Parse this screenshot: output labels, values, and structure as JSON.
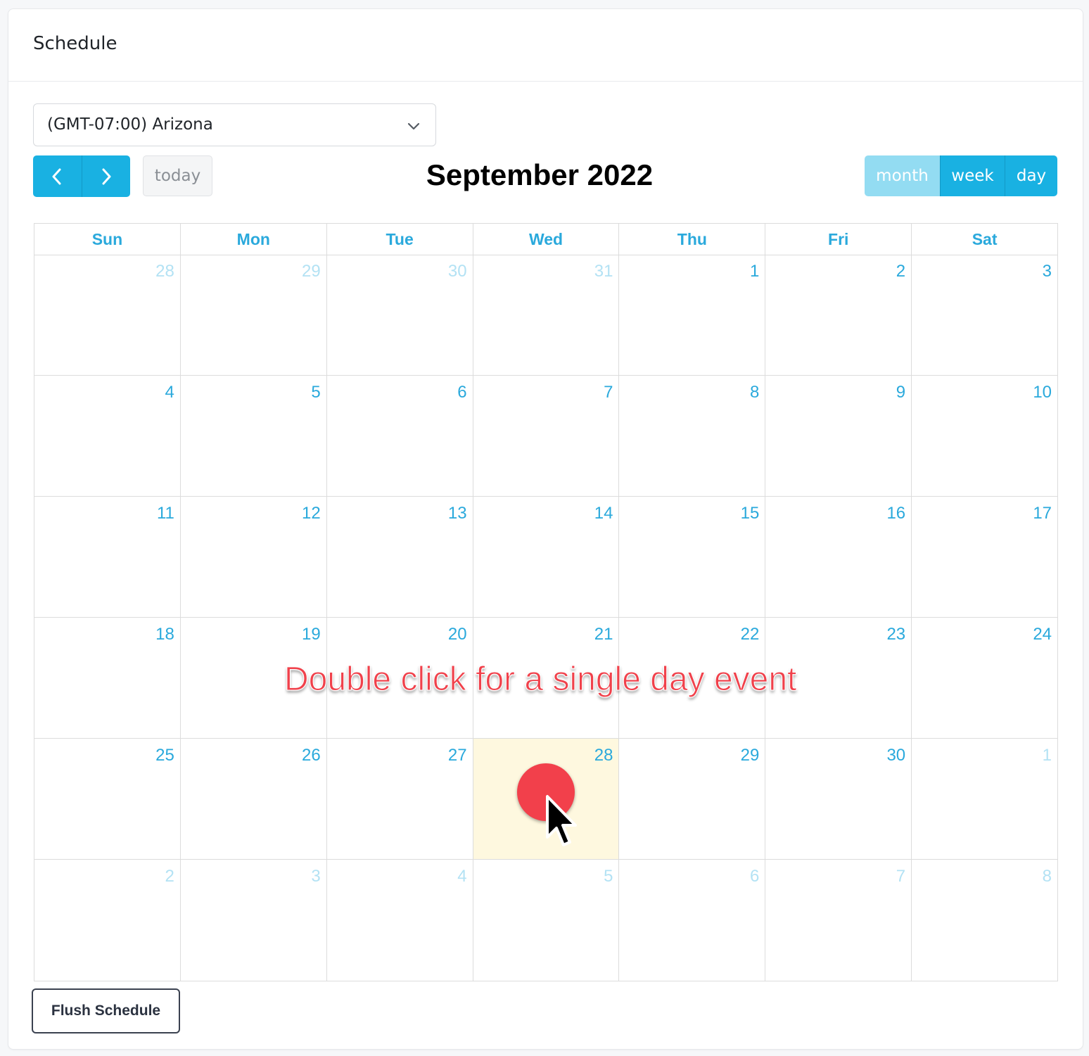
{
  "card": {
    "title": "Schedule"
  },
  "timezone": {
    "selected": "(GMT-07:00) Arizona"
  },
  "toolbar": {
    "prev_icon": "chevron-left-icon",
    "next_icon": "chevron-right-icon",
    "today_label": "today",
    "title": "September 2022",
    "views": [
      {
        "label": "month",
        "active": true
      },
      {
        "label": "week",
        "active": false
      },
      {
        "label": "day",
        "active": false
      }
    ]
  },
  "calendar": {
    "days_of_week": [
      "Sun",
      "Mon",
      "Tue",
      "Wed",
      "Thu",
      "Fri",
      "Sat"
    ],
    "weeks": [
      [
        {
          "n": "28",
          "other": true
        },
        {
          "n": "29",
          "other": true
        },
        {
          "n": "30",
          "other": true
        },
        {
          "n": "31",
          "other": true
        },
        {
          "n": "1"
        },
        {
          "n": "2"
        },
        {
          "n": "3"
        }
      ],
      [
        {
          "n": "4"
        },
        {
          "n": "5"
        },
        {
          "n": "6"
        },
        {
          "n": "7"
        },
        {
          "n": "8"
        },
        {
          "n": "9"
        },
        {
          "n": "10"
        }
      ],
      [
        {
          "n": "11"
        },
        {
          "n": "12"
        },
        {
          "n": "13"
        },
        {
          "n": "14"
        },
        {
          "n": "15"
        },
        {
          "n": "16"
        },
        {
          "n": "17"
        }
      ],
      [
        {
          "n": "18"
        },
        {
          "n": "19"
        },
        {
          "n": "20"
        },
        {
          "n": "21"
        },
        {
          "n": "22"
        },
        {
          "n": "23"
        },
        {
          "n": "24"
        }
      ],
      [
        {
          "n": "25"
        },
        {
          "n": "26"
        },
        {
          "n": "27"
        },
        {
          "n": "28",
          "today": true
        },
        {
          "n": "29"
        },
        {
          "n": "30"
        },
        {
          "n": "1",
          "other": true
        }
      ],
      [
        {
          "n": "2",
          "other": true
        },
        {
          "n": "3",
          "other": true
        },
        {
          "n": "4",
          "other": true
        },
        {
          "n": "5",
          "other": true
        },
        {
          "n": "6",
          "other": true
        },
        {
          "n": "7",
          "other": true
        },
        {
          "n": "8",
          "other": true
        }
      ]
    ]
  },
  "annotation": {
    "hint": "Double click for a single day event",
    "click_marker_color": "#f2404b"
  },
  "footer": {
    "flush_label": "Flush Schedule"
  },
  "colors": {
    "accent": "#19b1e2",
    "accent_active": "#93dcf2",
    "day_number": "#2aa9dc",
    "other_month_number": "#b3e2f4",
    "today_bg": "#fef8df"
  }
}
